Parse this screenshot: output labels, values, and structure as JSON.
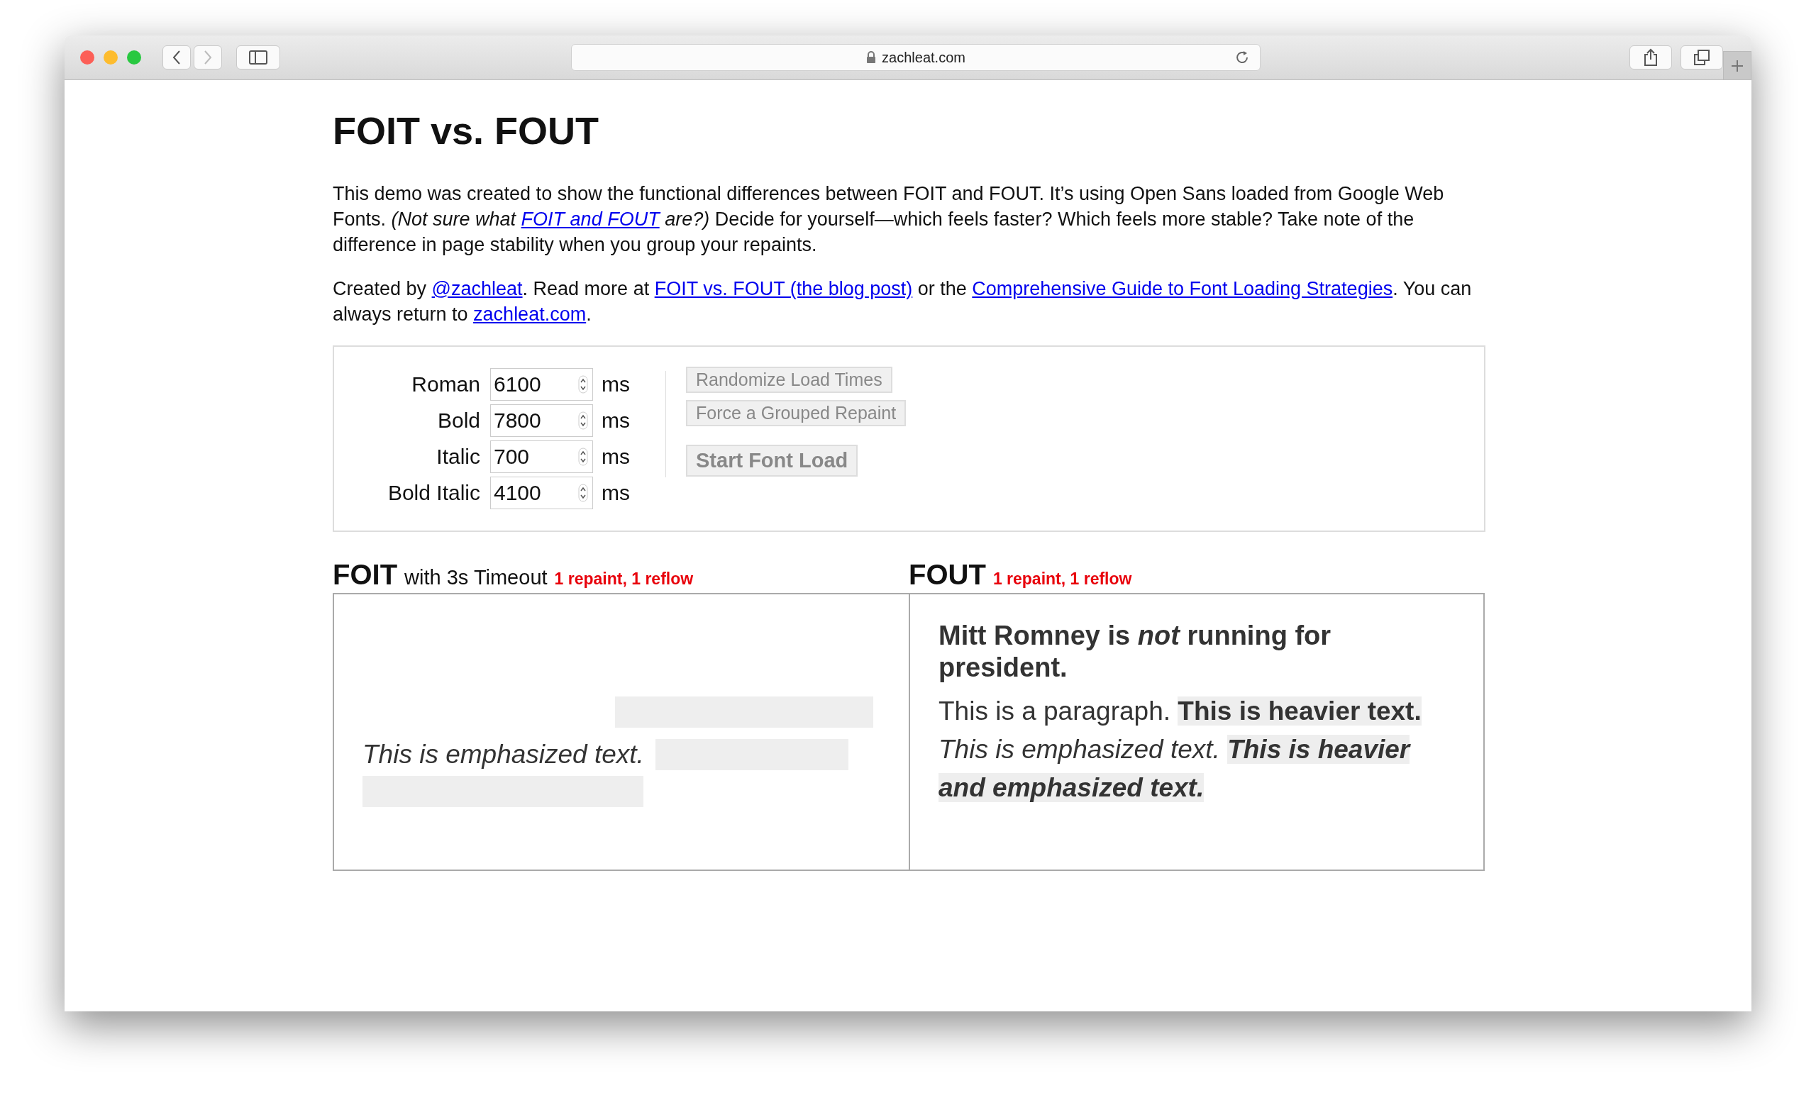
{
  "browser": {
    "url": "zachleat.com"
  },
  "page": {
    "title": "FOIT vs. FOUT",
    "paragraphs": [
      [
        {
          "kind": "text",
          "text": "This demo was created to show the functional differences between FOIT and FOUT. It’s using Open Sans loaded from Google Web Fonts. "
        },
        {
          "kind": "italic",
          "text": "(Not sure what "
        },
        {
          "kind": "italic-link",
          "text": "FOIT and FOUT"
        },
        {
          "kind": "italic",
          "text": " are?)"
        },
        {
          "kind": "text",
          "text": " Decide for yourself—which feels faster? Which feels more stable? Take note of the difference in page stability when you group your repaints."
        }
      ],
      [
        {
          "kind": "text",
          "text": "Created by "
        },
        {
          "kind": "link",
          "text": "@zachleat"
        },
        {
          "kind": "text",
          "text": ". Read more at "
        },
        {
          "kind": "link",
          "text": "FOIT vs. FOUT (the blog post)"
        },
        {
          "kind": "text",
          "text": " or the "
        },
        {
          "kind": "link",
          "text": "Comprehensive Guide to Font Loading Strategies"
        },
        {
          "kind": "text",
          "text": ". You can always return to "
        },
        {
          "kind": "link",
          "text": "zachleat.com"
        },
        {
          "kind": "text",
          "text": "."
        }
      ]
    ]
  },
  "controls": {
    "fields": [
      {
        "label": "Roman",
        "value": "6100",
        "unit": "ms"
      },
      {
        "label": "Bold",
        "value": "7800",
        "unit": "ms"
      },
      {
        "label": "Italic",
        "value": "700",
        "unit": "ms"
      },
      {
        "label": "Bold Italic",
        "value": "4100",
        "unit": "ms"
      }
    ],
    "buttons": [
      {
        "label": "Randomize Load Times",
        "kind": "secondary"
      },
      {
        "label": "Force a Grouped Repaint",
        "kind": "secondary"
      },
      {
        "label": "Start Font Load",
        "kind": "primary"
      }
    ]
  },
  "panels": [
    {
      "kind": "foit",
      "title": "FOIT",
      "subtitle": "with 3s Timeout",
      "status": "1 repaint, 1 reflow",
      "segments": [
        {
          "kind": "blank"
        },
        {
          "kind": "hidden"
        },
        {
          "kind": "break"
        },
        {
          "kind": "italic",
          "text": "This is emphasized text."
        },
        {
          "kind": "hidden"
        },
        {
          "kind": "hidden"
        }
      ]
    },
    {
      "kind": "fout",
      "title": "FOUT",
      "status": "1 repaint, 1 reflow",
      "heading": "Mitt Romney is *not* running for president.",
      "segments": [
        {
          "kind": "regular",
          "text": "This is a paragraph."
        },
        {
          "kind": "bold",
          "text": "This is heavier text."
        },
        {
          "kind": "italic",
          "text": "This is emphasized text."
        },
        {
          "kind": "bold-italic",
          "text": "This is heavier and emphasized text."
        }
      ]
    }
  ]
}
